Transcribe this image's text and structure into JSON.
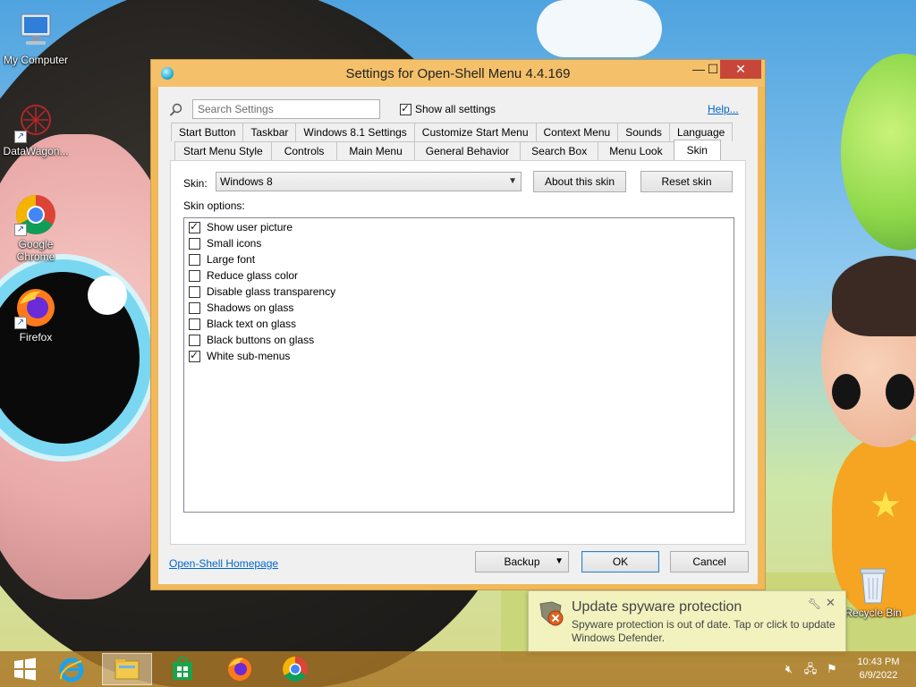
{
  "desktop": {
    "icons": [
      {
        "label": "My Computer"
      },
      {
        "label": "DataWagon..."
      },
      {
        "label": "Google Chrome"
      },
      {
        "label": "Firefox"
      }
    ],
    "recycle_bin": "Recycle Bin"
  },
  "dialog": {
    "title": "Settings for Open-Shell Menu 4.4.169",
    "search": {
      "placeholder": "Search Settings",
      "value": ""
    },
    "show_all": {
      "label": "Show all settings",
      "checked": true
    },
    "help_link": "Help...",
    "tabs_row1": [
      "Start Button",
      "Taskbar",
      "Windows 8.1 Settings",
      "Customize Start Menu",
      "Context Menu",
      "Sounds",
      "Language"
    ],
    "tabs_row2": [
      "Start Menu Style",
      "Controls",
      "Main Menu",
      "General Behavior",
      "Search Box",
      "Menu Look",
      "Skin"
    ],
    "active_tab": "Skin",
    "skin": {
      "label": "Skin:",
      "selected": "Windows 8",
      "about_button": "About this skin",
      "reset_button": "Reset skin",
      "options_label": "Skin options:",
      "options": [
        {
          "label": "Show user picture",
          "checked": true
        },
        {
          "label": "Small icons",
          "checked": false
        },
        {
          "label": "Large font",
          "checked": false
        },
        {
          "label": "Reduce glass color",
          "checked": false
        },
        {
          "label": "Disable glass transparency",
          "checked": false
        },
        {
          "label": "Shadows on glass",
          "checked": false
        },
        {
          "label": "Black text on glass",
          "checked": false
        },
        {
          "label": "Black buttons on glass",
          "checked": false
        },
        {
          "label": "White sub-menus",
          "checked": true
        }
      ]
    },
    "footer": {
      "homepage_link": "Open-Shell Homepage",
      "backup_button": "Backup",
      "ok_button": "OK",
      "cancel_button": "Cancel"
    }
  },
  "notification": {
    "title": "Update spyware protection",
    "message": "Spyware protection is out of date. Tap or click to update Windows Defender."
  },
  "taskbar": {
    "clock": {
      "time": "10:43 PM",
      "date": "6/9/2022"
    }
  }
}
